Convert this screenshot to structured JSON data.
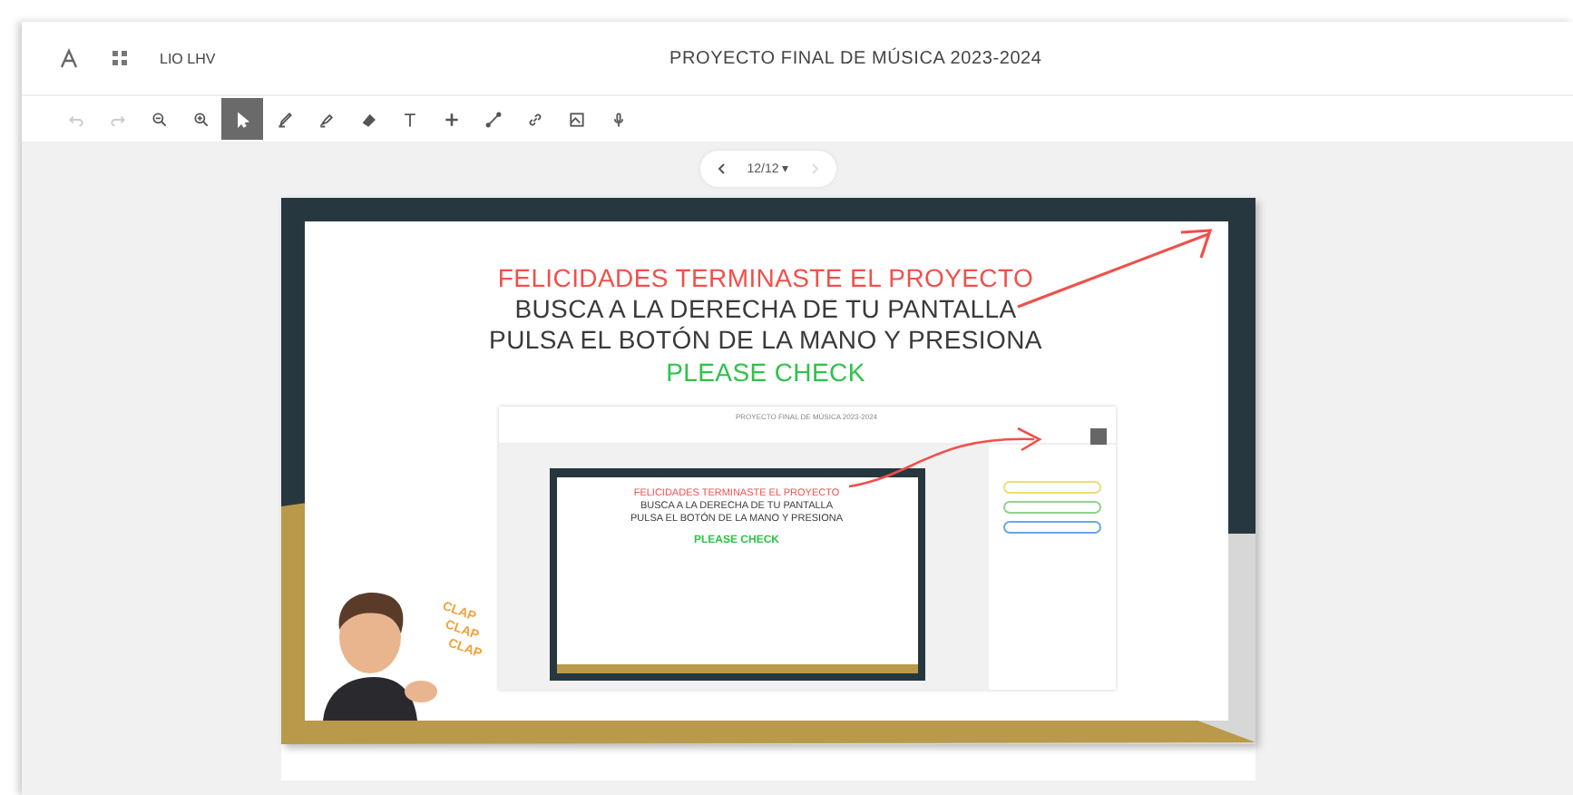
{
  "header": {
    "user": "LIO LHV",
    "title": "PROYECTO FINAL DE MÚSICA 2023-2024"
  },
  "tools": [
    {
      "kind": "undo",
      "selected": false,
      "disabled": true
    },
    {
      "kind": "redo",
      "selected": false,
      "disabled": true
    },
    {
      "kind": "zoom-out",
      "selected": false,
      "disabled": false
    },
    {
      "kind": "zoom-in",
      "selected": false,
      "disabled": false
    },
    {
      "kind": "select",
      "selected": true,
      "disabled": false
    },
    {
      "kind": "pen",
      "selected": false,
      "disabled": false
    },
    {
      "kind": "highlighter",
      "selected": false,
      "disabled": false
    },
    {
      "kind": "eraser",
      "selected": false,
      "disabled": false
    },
    {
      "kind": "text",
      "selected": false,
      "disabled": false
    },
    {
      "kind": "plus",
      "selected": false,
      "disabled": false
    },
    {
      "kind": "line",
      "selected": false,
      "disabled": false
    },
    {
      "kind": "link",
      "selected": false,
      "disabled": false
    },
    {
      "kind": "image",
      "selected": false,
      "disabled": false
    },
    {
      "kind": "mic",
      "selected": false,
      "disabled": false
    }
  ],
  "pager": {
    "label": "12/12 ▾",
    "next_disabled": true
  },
  "slide": {
    "lines": [
      {
        "text": "FELICIDADES TERMINASTE EL PROYECTO",
        "color": "#f0504a"
      },
      {
        "text": "BUSCA A LA DERECHA DE TU PANTALLA",
        "color": "#3a3a3a"
      },
      {
        "text": "PULSA EL BOTÓN DE LA MANO Y PRESIONA",
        "color": "#3a3a3a"
      },
      {
        "text": "PLEASE CHECK",
        "color": "#2fc24a"
      }
    ],
    "clap": [
      "CLAP",
      "CLAP",
      "CLAP"
    ],
    "screenshot": {
      "title": "PROYECTO FINAL DE MÚSICA 2023-2024",
      "lines": [
        {
          "text": "FELICIDADES TERMINASTE EL PROYECTO",
          "color": "#f0504a"
        },
        {
          "text": "BUSCA A LA DERECHA DE TU PANTALLA",
          "color": "#3a3a3a"
        },
        {
          "text": "PULSA EL BOTÓN DE LA MANO Y PRESIONA",
          "color": "#3a3a3a"
        },
        {
          "text": "PLEASE CHECK",
          "color": "#2fc24a"
        }
      ]
    }
  }
}
